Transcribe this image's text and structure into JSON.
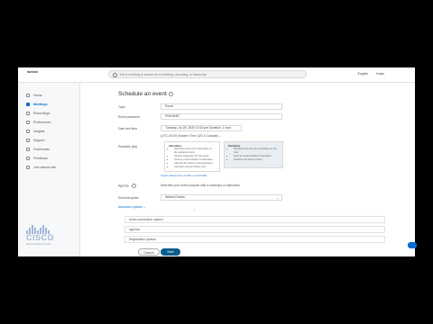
{
  "header": {
    "brand": "webex",
    "search_placeholder": "Join a meeting or search for a meeting, recording, or transcript",
    "right_items": [
      "English",
      "Hosts"
    ]
  },
  "sidebar": {
    "items": [
      {
        "label": "Home"
      },
      {
        "label": "Meetings"
      },
      {
        "label": "Recordings"
      },
      {
        "label": "Preferences"
      },
      {
        "label": "Insights"
      },
      {
        "label": "Support"
      },
      {
        "label": "Downloads"
      },
      {
        "label": "Feedback"
      },
      {
        "label": "Join classic site"
      }
    ],
    "logo": {
      "name": "CISCO",
      "tagline": "Webex Event Center"
    }
  },
  "form": {
    "title": "Schedule an event",
    "topic_label": "Topic",
    "topic_value": "Event",
    "password_label": "Event password",
    "password_value": "Pr0m3H67",
    "datetime_label": "Date and time",
    "datetime_value": "Tuesday, Jul 28, 2020  10:15 pm  Duration: 1 hour",
    "timezone_value": "(UTC-05:00) Eastern Time (US & Canada)",
    "attendees_label": "Panelists (list)",
    "left_box": {
      "title": "Attendees",
      "items": [
        "Attendees must enter information on the registration form",
        "Require registration for this event",
        "Send an email invitation to attendees",
        "Attendee list shown to all participants",
        "Attendees can join before host"
      ]
    },
    "right_box": {
      "title": "Panelists",
      "items": [
        "Panelists have the same privileges as the host",
        "Send an email invitation to panelists",
        "Panelists can share content"
      ]
    },
    "template_link": "Import values from a CSV or vCard file",
    "agenda_label": "Agenda",
    "agenda_value": "Describe your event purpose with a summary of objectives",
    "template_label": "Event template",
    "template_value": "Webex Events",
    "advanced_link": "Advanced options",
    "sub_rows": [
      "Audio connection options",
      "Agenda",
      "Registration options"
    ],
    "cancel_label": "Cancel",
    "start_label": "Start"
  }
}
